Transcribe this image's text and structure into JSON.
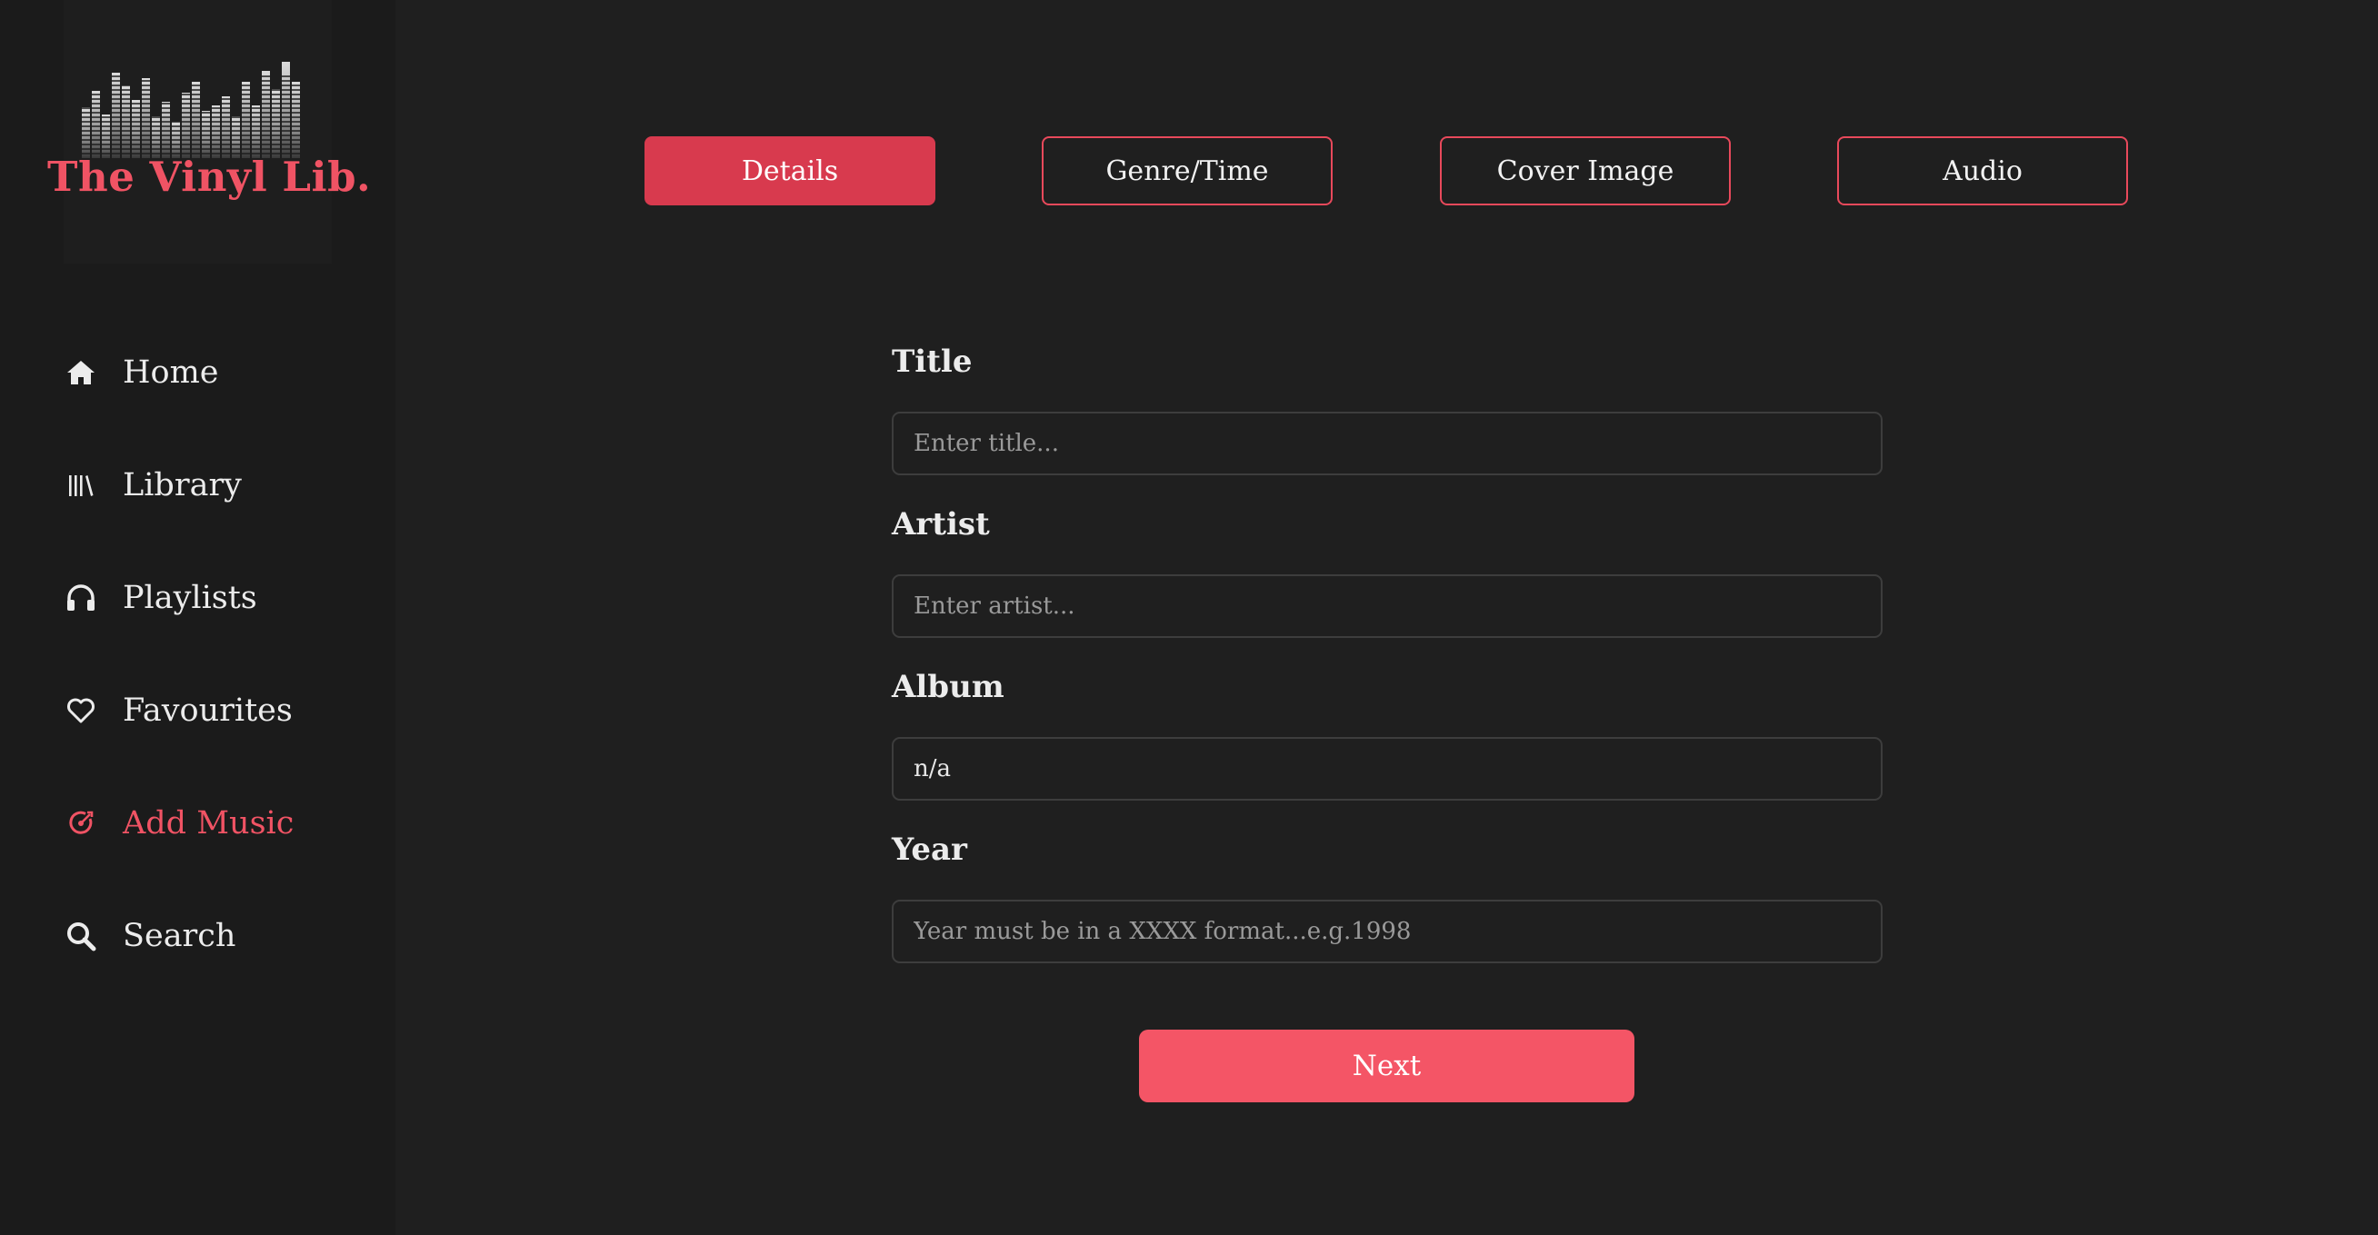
{
  "brand": {
    "name": "The Vinyl Lib.",
    "accent_color": "#f05364"
  },
  "sidebar": {
    "items": [
      {
        "label": "Home",
        "icon": "home-icon"
      },
      {
        "label": "Library",
        "icon": "library-icon"
      },
      {
        "label": "Playlists",
        "icon": "headphones-icon"
      },
      {
        "label": "Favourites",
        "icon": "heart-icon"
      },
      {
        "label": "Add Music",
        "icon": "add-music-icon",
        "active": true
      },
      {
        "label": "Search",
        "icon": "search-icon"
      }
    ]
  },
  "tabs": [
    {
      "label": "Details",
      "active": true
    },
    {
      "label": "Genre/Time"
    },
    {
      "label": "Cover Image"
    },
    {
      "label": "Audio"
    }
  ],
  "form": {
    "title": {
      "label": "Title",
      "value": "",
      "placeholder": "Enter title..."
    },
    "artist": {
      "label": "Artist",
      "value": "",
      "placeholder": "Enter artist..."
    },
    "album": {
      "label": "Album",
      "value": "n/a",
      "placeholder": ""
    },
    "year": {
      "label": "Year",
      "value": "",
      "placeholder": "Year must be in a XXXX format...e.g.1998"
    },
    "next_label": "Next"
  }
}
